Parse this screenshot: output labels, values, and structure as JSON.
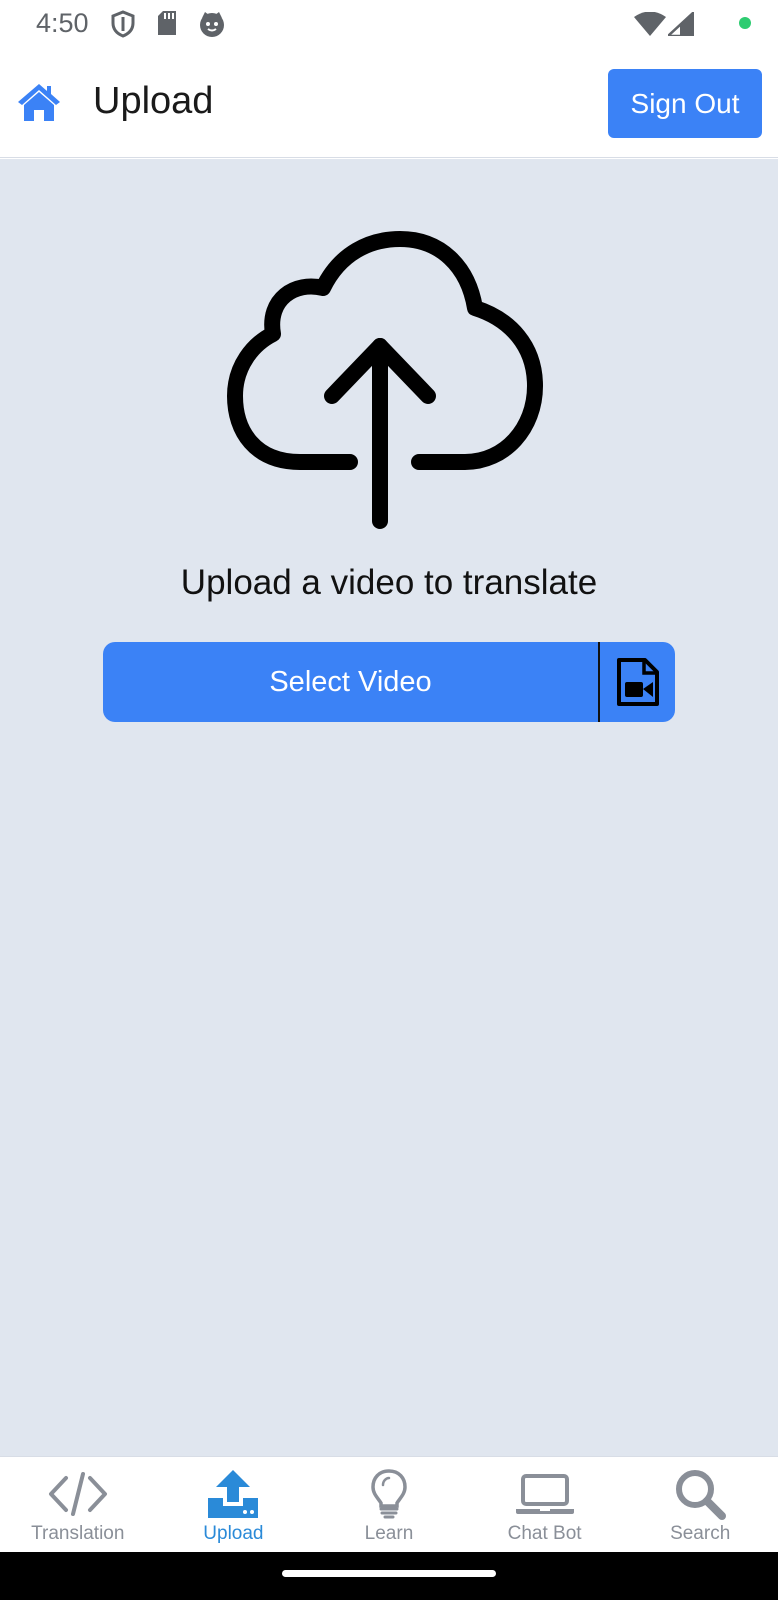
{
  "status_bar": {
    "time": "4:50",
    "icons": [
      "shield-icon",
      "sd-card-icon",
      "cat-face-icon",
      "wifi-icon",
      "cell-signal-icon"
    ],
    "indicator_color": "#2ecc71"
  },
  "header": {
    "home_icon": "home-icon",
    "title": "Upload",
    "sign_out_label": "Sign Out"
  },
  "main": {
    "hero_icon": "cloud-upload-icon",
    "prompt": "Upload a video to translate",
    "select_video_label": "Select Video",
    "select_video_icon": "video-file-icon"
  },
  "bottom_nav": {
    "items": [
      {
        "label": "Translation",
        "icon": "code-icon",
        "active": false
      },
      {
        "label": "Upload",
        "icon": "upload-icon",
        "active": true
      },
      {
        "label": "Learn",
        "icon": "lightbulb-icon",
        "active": false
      },
      {
        "label": "Chat Bot",
        "icon": "laptop-icon",
        "active": false
      },
      {
        "label": "Search",
        "icon": "search-icon",
        "active": false
      }
    ]
  },
  "colors": {
    "accent": "#3b82f6",
    "background": "#e0e6ef",
    "nav_active": "#2a8ad8",
    "nav_inactive": "#8a8f98"
  }
}
